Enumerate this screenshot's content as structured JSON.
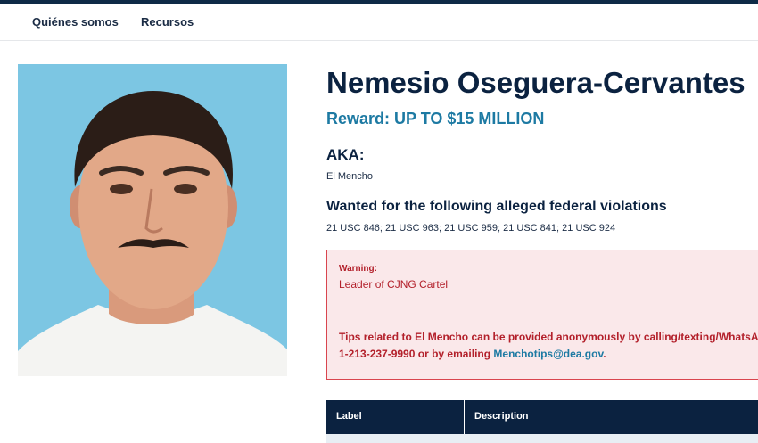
{
  "nav": {
    "items": [
      "Quiénes somos",
      "Recursos"
    ]
  },
  "profile": {
    "name": "Nemesio Oseguera-Cervantes",
    "reward": "Reward: UP TO $15 MILLION",
    "aka_heading": "AKA:",
    "aka_value": "El Mencho",
    "violations_heading": "Wanted for the following alleged federal violations",
    "violations_value": "21 USC 846; 21 USC 963; 21 USC 959; 21 USC 841; 21 USC 924"
  },
  "warning": {
    "label": "Warning:",
    "text": "Leader of CJNG Cartel",
    "tips_line1": "Tips related to El Mencho can be provided anonymously by calling/texting/WhatsA",
    "tips_line2_prefix": "1-213-237-9990 or by emailing ",
    "tips_email": "Menchotips@dea.gov",
    "tips_suffix": "."
  },
  "table": {
    "headers": [
      "Label",
      "Description"
    ]
  },
  "colors": {
    "navy": "#0b2240",
    "accent": "#1d7aa3",
    "warning": "#b3202b",
    "warning_bg": "#fae8ea",
    "photo_bg": "#7cc6e3"
  }
}
